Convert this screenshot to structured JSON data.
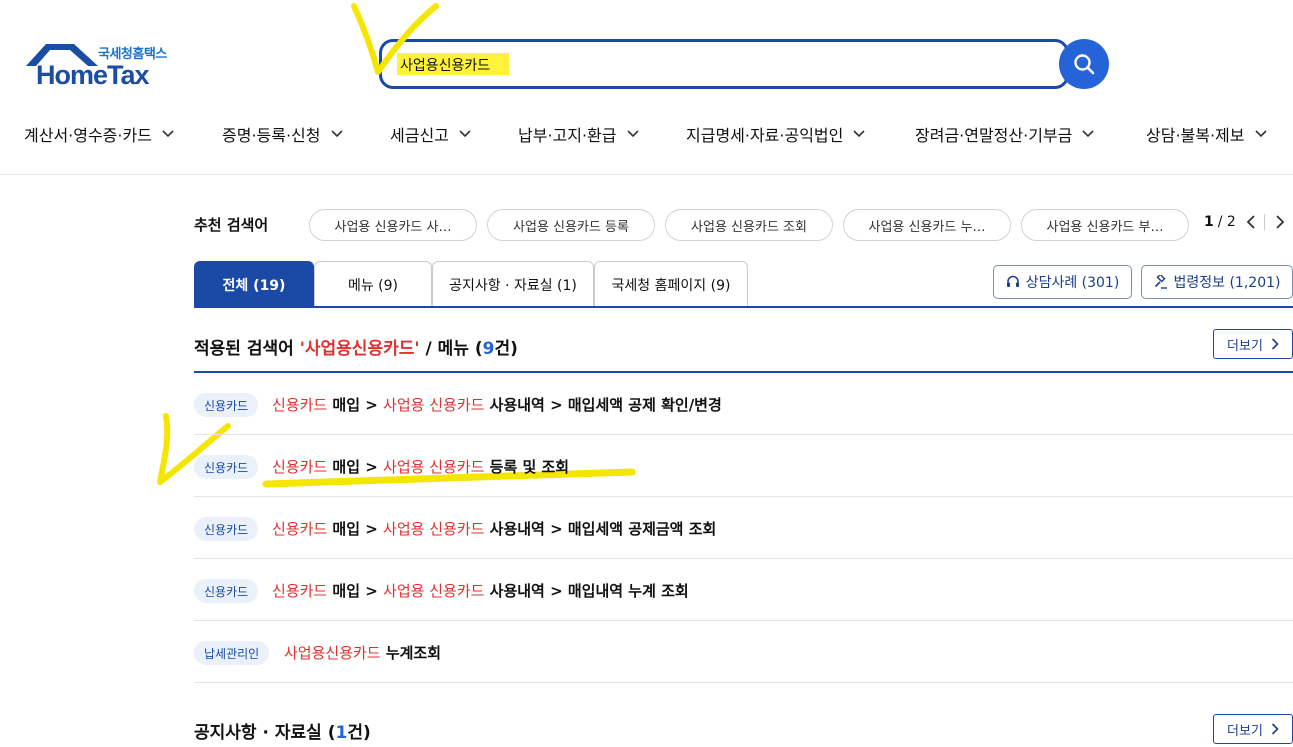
{
  "logo": {
    "small": "국세청홈택스",
    "big": "HomeTax"
  },
  "search": {
    "value": "사업용신용카드"
  },
  "nav": [
    {
      "label": "계산서·영수증·카드"
    },
    {
      "label": "증명·등록·신청"
    },
    {
      "label": "세금신고"
    },
    {
      "label": "납부·고지·환급"
    },
    {
      "label": "지급명세·자료·공익법인"
    },
    {
      "label": "장려금·연말정산·기부금"
    },
    {
      "label": "상담·불복·제보"
    }
  ],
  "recommend": {
    "label": "추천 검색어",
    "chips": [
      "사업용 신용카드 사…",
      "사업용 신용카드 등록",
      "사업용 신용카드 조회",
      "사업용 신용카드 누…",
      "사업용 신용카드 부…"
    ],
    "page_current": "1",
    "page_total": "/ 2"
  },
  "tabs": [
    {
      "label": "전체 (19)"
    },
    {
      "label": "메뉴 (9)"
    },
    {
      "label": "공지사항 · 자료실 (1)"
    },
    {
      "label": "국세청 홈페이지 (9)"
    }
  ],
  "side_buttons": {
    "consult": "상담사례 (301)",
    "law": "법령정보 (1,201)"
  },
  "section_menu": {
    "prefix": "적용된 검색어 ",
    "query": "'사업용신용카드'",
    "mid": " / 메뉴 (",
    "count": "9",
    "suffix": "건)",
    "more": "더보기"
  },
  "results": [
    {
      "badge": "신용카드",
      "p1": "신용카드",
      "p2": " 매입 > ",
      "p3": "사업용 신용카드",
      "p4": " 사용내역 > 매입세액 공제 확인/변경"
    },
    {
      "badge": "신용카드",
      "p1": "신용카드",
      "p2": " 매입 > ",
      "p3": "사업용 신용카드",
      "p4": " 등록 및 조회"
    },
    {
      "badge": "신용카드",
      "p1": "신용카드",
      "p2": " 매입 > ",
      "p3": "사업용 신용카드",
      "p4": " 사용내역 > 매입세액 공제금액 조회"
    },
    {
      "badge": "신용카드",
      "p1": "신용카드",
      "p2": " 매입 > ",
      "p3": "사업용 신용카드",
      "p4": " 사용내역 > 매입내역 누계 조회"
    },
    {
      "badge": "납세관리인",
      "p1": "사업용신용카드",
      "p2": " 누계조회",
      "p3": "",
      "p4": ""
    }
  ],
  "section_notice": {
    "prefix": "공지사항 · 자료실 (",
    "count": "1",
    "suffix": "건)",
    "more": "더보기"
  }
}
